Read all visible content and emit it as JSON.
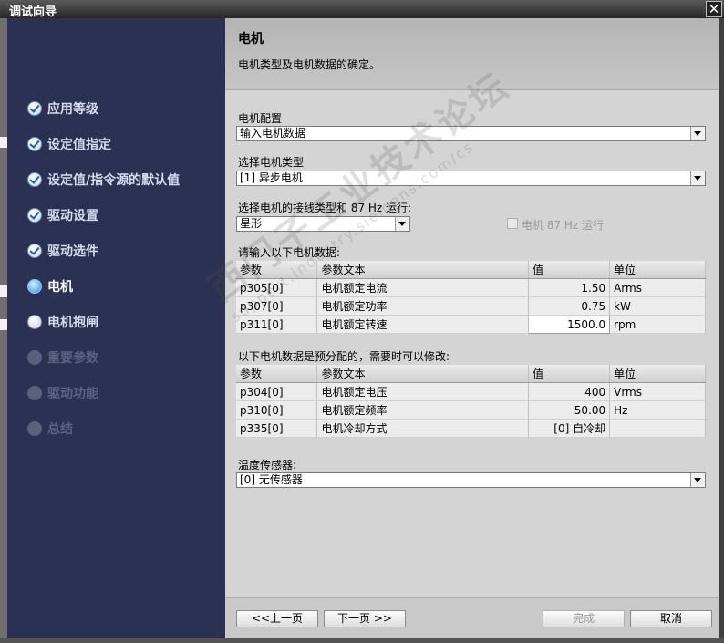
{
  "window": {
    "title": "调试向导",
    "close_glyph": "✕"
  },
  "sidebar": {
    "items": [
      {
        "label": "应用等级",
        "state": "done"
      },
      {
        "label": "设定值指定",
        "state": "done"
      },
      {
        "label": "设定值/指令源的默认值",
        "state": "done"
      },
      {
        "label": "驱动设置",
        "state": "done"
      },
      {
        "label": "驱动选件",
        "state": "done"
      },
      {
        "label": "电机",
        "state": "active"
      },
      {
        "label": "电机抱闸",
        "state": "pending"
      },
      {
        "label": "重要参数",
        "state": "disabled"
      },
      {
        "label": "驱动功能",
        "state": "disabled"
      },
      {
        "label": "总结",
        "state": "disabled"
      }
    ]
  },
  "header": {
    "title": "电机",
    "subtitle": "电机类型及电机数据的确定。"
  },
  "motor_config": {
    "label": "电机配置",
    "value": "输入电机数据"
  },
  "motor_type": {
    "label": "选择电机类型",
    "value": "[1] 异步电机"
  },
  "wiring": {
    "label": "选择电机的接线类型和 87 Hz 运行:",
    "value": "星形",
    "checkbox_label": "电机 87 Hz 运行",
    "checked": false
  },
  "input_data": {
    "label": "请输入以下电机数据:",
    "columns": [
      "参数",
      "参数文本",
      "值",
      "单位"
    ],
    "rows": [
      {
        "param": "p305[0]",
        "text": "电机额定电流",
        "value": "1.50",
        "unit": "Arms"
      },
      {
        "param": "p307[0]",
        "text": "电机额定功率",
        "value": "0.75",
        "unit": "kW"
      },
      {
        "param": "p311[0]",
        "text": "电机额定转速",
        "value": "1500.0",
        "unit": "rpm"
      }
    ]
  },
  "preset_data": {
    "label": "以下电机数据是预分配的，需要时可以修改:",
    "columns": [
      "参数",
      "参数文本",
      "值",
      "单位"
    ],
    "rows": [
      {
        "param": "p304[0]",
        "text": "电机额定电压",
        "value": "400",
        "unit": "Vrms"
      },
      {
        "param": "p310[0]",
        "text": "电机额定频率",
        "value": "50.00",
        "unit": "Hz"
      },
      {
        "param": "p335[0]",
        "text": "电机冷却方式",
        "value": "[0] 自冷却",
        "unit": ""
      }
    ]
  },
  "temp_sensor": {
    "label": "温度传感器:",
    "value": "[0] 无传感器"
  },
  "buttons": {
    "prev": "<<上一页",
    "next": "下一页 >>",
    "finish": "完成",
    "cancel": "取消"
  },
  "watermark": {
    "main": "西门子工业技术论坛",
    "sub": "support.industry.siemens.com/cs"
  },
  "colors": {
    "sidebar_bg": "#2b3152",
    "content_bg": "#d4d4d4",
    "header_bg": "#bcbcbc",
    "active_icon": "#2c8fd2"
  }
}
